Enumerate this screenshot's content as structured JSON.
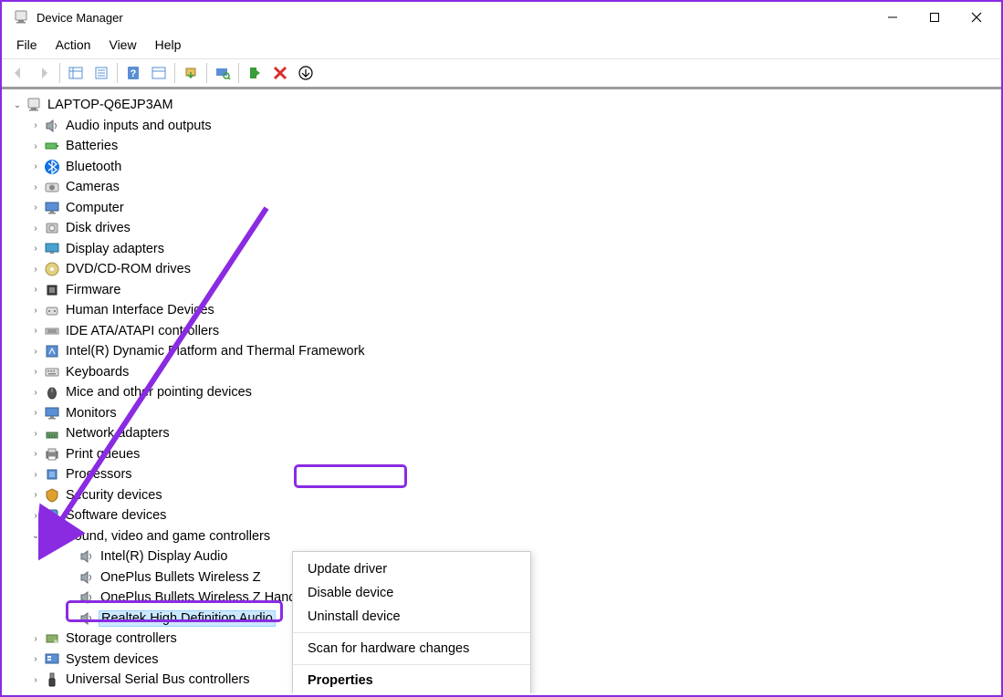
{
  "window": {
    "title": "Device Manager"
  },
  "menu": {
    "file": "File",
    "action": "Action",
    "view": "View",
    "help": "Help"
  },
  "root": {
    "name": "LAPTOP-Q6EJP3AM"
  },
  "categories": [
    {
      "label": "Audio inputs and outputs",
      "icon": "speaker"
    },
    {
      "label": "Batteries",
      "icon": "battery"
    },
    {
      "label": "Bluetooth",
      "icon": "bluetooth"
    },
    {
      "label": "Cameras",
      "icon": "camera"
    },
    {
      "label": "Computer",
      "icon": "monitor"
    },
    {
      "label": "Disk drives",
      "icon": "disk"
    },
    {
      "label": "Display adapters",
      "icon": "display"
    },
    {
      "label": "DVD/CD-ROM drives",
      "icon": "disc"
    },
    {
      "label": "Firmware",
      "icon": "chip"
    },
    {
      "label": "Human Interface Devices",
      "icon": "hid"
    },
    {
      "label": "IDE ATA/ATAPI controllers",
      "icon": "ide"
    },
    {
      "label": "Intel(R) Dynamic Platform and Thermal Framework",
      "icon": "thermal"
    },
    {
      "label": "Keyboards",
      "icon": "keyboard"
    },
    {
      "label": "Mice and other pointing devices",
      "icon": "mouse"
    },
    {
      "label": "Monitors",
      "icon": "monitor"
    },
    {
      "label": "Network adapters",
      "icon": "network"
    },
    {
      "label": "Print queues",
      "icon": "printer"
    },
    {
      "label": "Processors",
      "icon": "cpu"
    },
    {
      "label": "Security devices",
      "icon": "security"
    },
    {
      "label": "Software devices",
      "icon": "software"
    },
    {
      "label": "Sound, video and game controllers",
      "icon": "speaker",
      "expanded": true,
      "children": [
        {
          "label": "Intel(R) Display Audio",
          "icon": "speaker"
        },
        {
          "label": "OnePlus Bullets Wireless Z",
          "icon": "speaker"
        },
        {
          "label": "OnePlus Bullets Wireless Z Hands-Free",
          "icon": "speaker"
        },
        {
          "label": "Realtek High Definition Audio",
          "icon": "speaker",
          "selected": true
        }
      ]
    },
    {
      "label": "Storage controllers",
      "icon": "storage"
    },
    {
      "label": "System devices",
      "icon": "system"
    },
    {
      "label": "Universal Serial Bus controllers",
      "icon": "usb"
    }
  ],
  "context_menu": {
    "update": "Update driver",
    "disable": "Disable device",
    "uninstall": "Uninstall device",
    "scan": "Scan for hardware changes",
    "properties": "Properties"
  },
  "annotations": {
    "highlight_item": "Realtek High Definition Audio",
    "highlight_menu": "Update driver"
  }
}
